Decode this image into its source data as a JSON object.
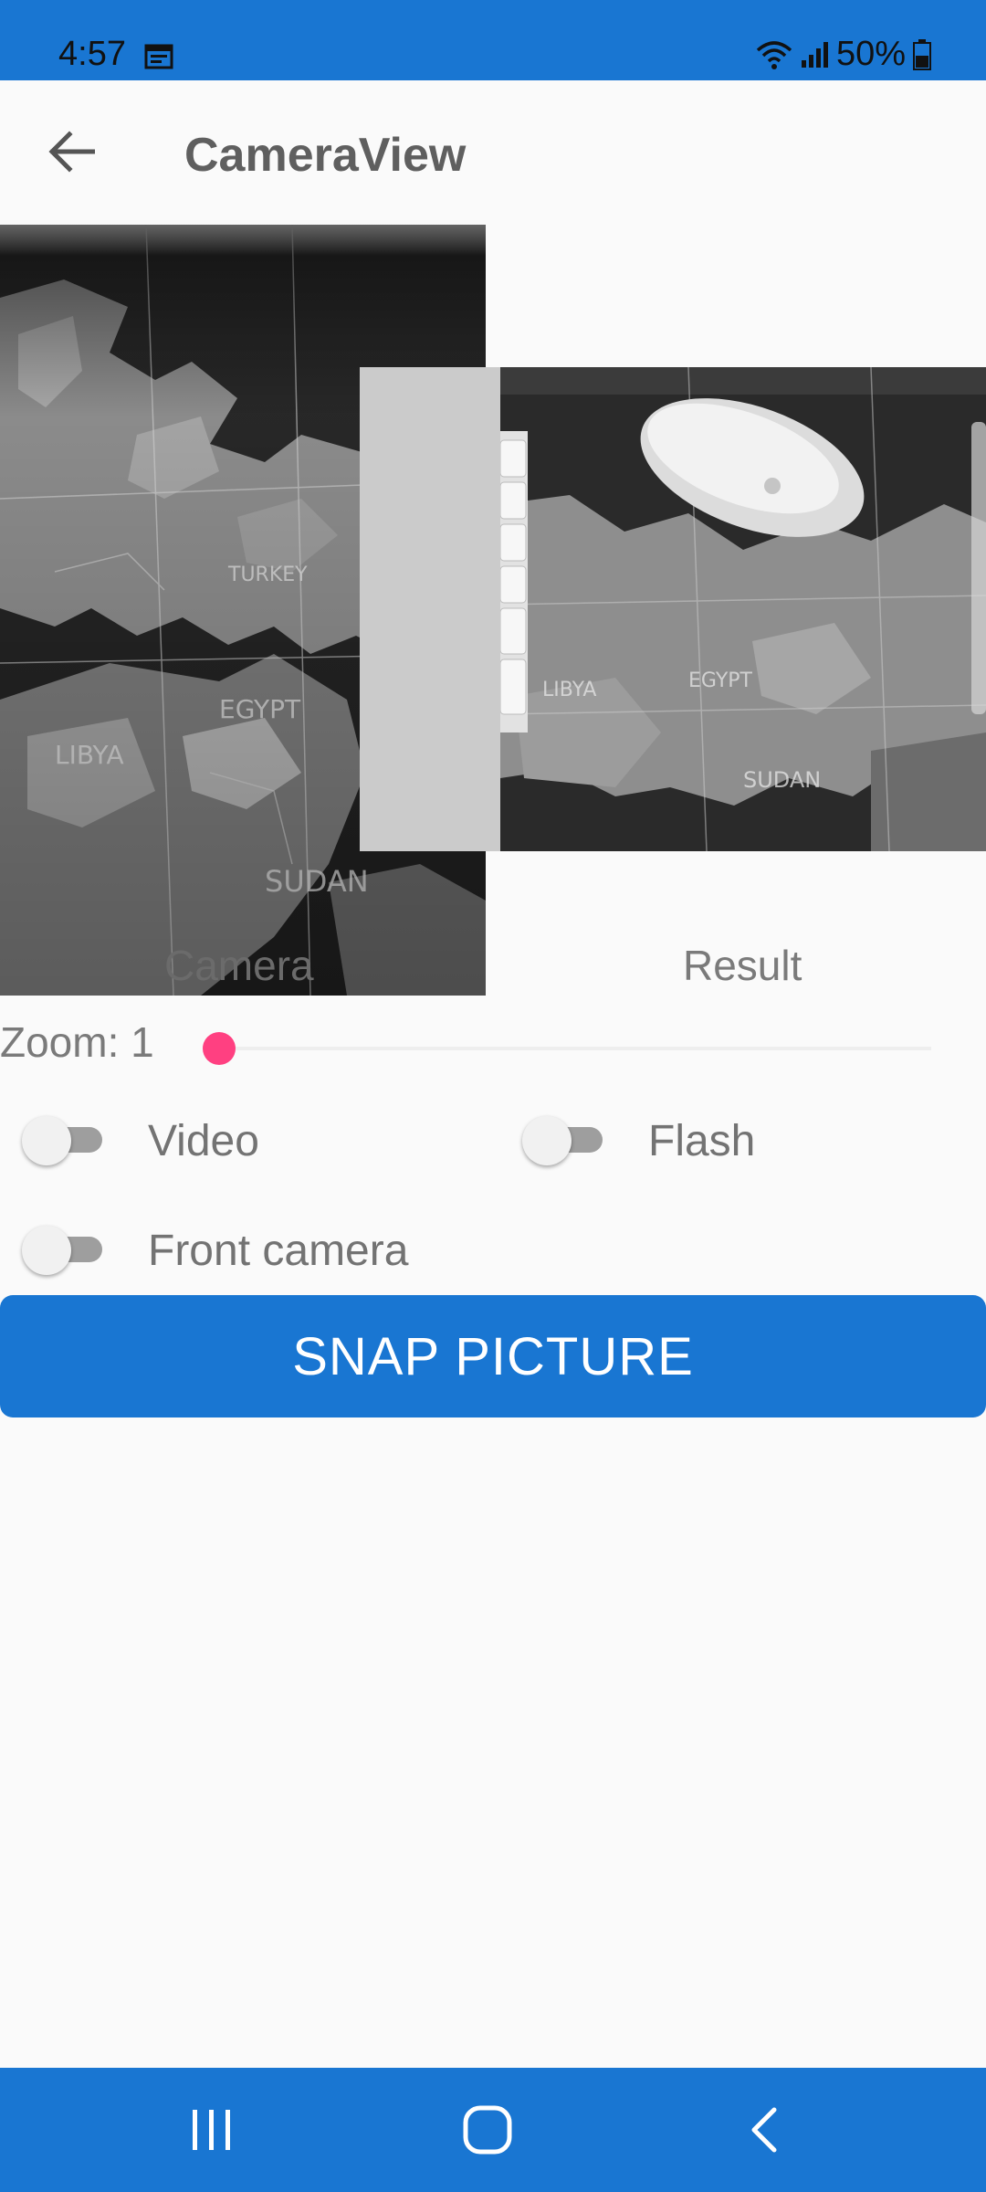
{
  "status_bar": {
    "time": "4:57",
    "battery": "50%",
    "icons": [
      "calendar-icon",
      "wifi-icon",
      "signal-icon",
      "battery-icon"
    ]
  },
  "app_bar": {
    "title": "CameraView",
    "back_icon": "arrow-left-icon"
  },
  "views": {
    "camera_label": "Camera",
    "result_label": "Result"
  },
  "zoom": {
    "label": "Zoom: 1",
    "slider_value": 1
  },
  "toggles": {
    "video": {
      "label": "Video",
      "checked": false
    },
    "flash": {
      "label": "Flash",
      "checked": false
    },
    "front_camera": {
      "label": "Front camera",
      "checked": false
    }
  },
  "snap_button": {
    "label": "SNAP PICTURE"
  },
  "nav_bar": {
    "icons": [
      "recent-apps-icon",
      "home-icon",
      "back-nav-icon"
    ]
  },
  "colors": {
    "primary": "#1976d2",
    "accent": "#ff4081",
    "background": "#fafafa"
  }
}
